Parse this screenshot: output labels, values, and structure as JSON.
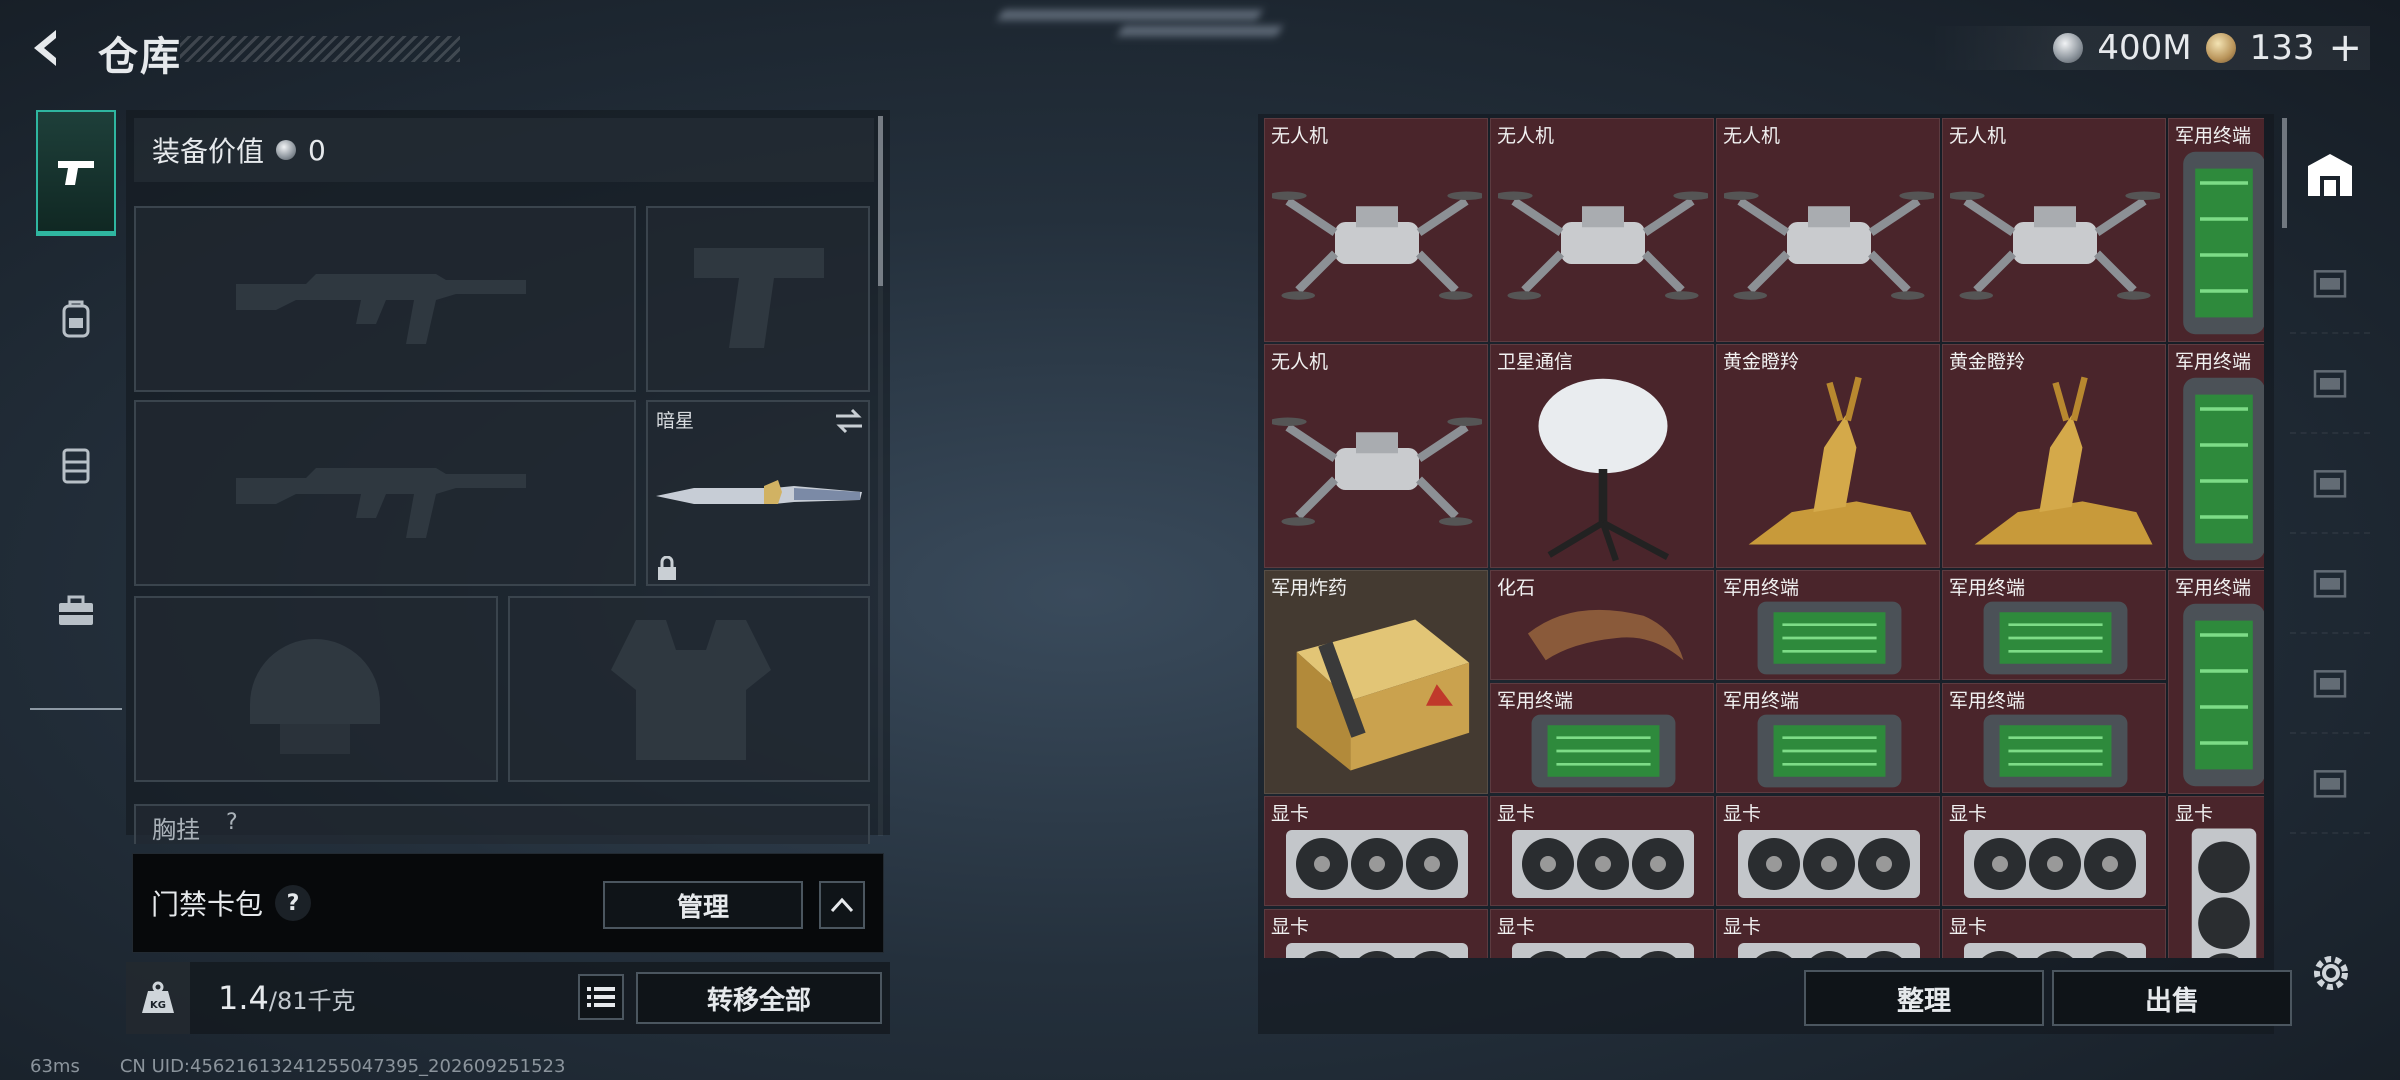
{
  "header": {
    "title": "仓库"
  },
  "currency": {
    "silver_value": "400M",
    "gold_value": "133",
    "add_label": "+"
  },
  "left_tabs": [
    {
      "icon": "pistol-icon",
      "active": true
    },
    {
      "icon": "backpack-icon",
      "active": false
    },
    {
      "icon": "vest-icon",
      "active": false
    },
    {
      "icon": "toolbox-icon",
      "active": false
    }
  ],
  "equipment": {
    "value_label": "装备价值",
    "value": "0",
    "melee_label": "暗星",
    "chest_label": "胸挂",
    "chest_help": "?"
  },
  "access_card": {
    "label": "门禁卡包",
    "help": "?",
    "manage_label": "管理"
  },
  "weight": {
    "current": "1.4",
    "capacity": "/81千克",
    "kg_label": "KG",
    "transfer_label": "转移全部"
  },
  "inventory": {
    "items": [
      {
        "name": "无人机",
        "type": "drone"
      },
      {
        "name": "无人机",
        "type": "drone"
      },
      {
        "name": "无人机",
        "type": "drone"
      },
      {
        "name": "无人机",
        "type": "drone"
      },
      {
        "name": "军用终端",
        "type": "terminal-tall"
      },
      {
        "name": "无人机",
        "type": "drone"
      },
      {
        "name": "卫星通信",
        "type": "satellite"
      },
      {
        "name": "黄金瞪羚",
        "type": "gazelle"
      },
      {
        "name": "黄金瞪羚",
        "type": "gazelle"
      },
      {
        "name": "军用终端",
        "type": "terminal-tall"
      },
      {
        "name": "军用炸药",
        "type": "explosive"
      },
      {
        "name": "化石",
        "type": "fossil"
      },
      {
        "name": "军用终端",
        "type": "terminal"
      },
      {
        "name": "军用终端",
        "type": "terminal"
      },
      {
        "name": "军用终端",
        "type": "terminal-tall"
      },
      {
        "name": "军用终端",
        "type": "terminal"
      },
      {
        "name": "军用终端",
        "type": "terminal"
      },
      {
        "name": "军用终端",
        "type": "terminal"
      },
      {
        "name": "显卡",
        "type": "gpu"
      },
      {
        "name": "显卡",
        "type": "gpu"
      },
      {
        "name": "显卡",
        "type": "gpu"
      },
      {
        "name": "显卡",
        "type": "gpu"
      },
      {
        "name": "显卡",
        "type": "gpu-tall"
      },
      {
        "name": "显卡",
        "type": "gpu"
      },
      {
        "name": "显卡",
        "type": "gpu"
      },
      {
        "name": "显卡",
        "type": "gpu"
      },
      {
        "name": "显卡",
        "type": "gpu"
      }
    ],
    "sort_label": "整理",
    "sell_label": "出售"
  },
  "right_tabs": [
    {
      "icon": "storage-icon",
      "active": true
    },
    {
      "icon": "storage-gti-icon",
      "active": false
    },
    {
      "icon": "storage-v-icon",
      "active": false
    },
    {
      "icon": "storage-iv-medical-icon",
      "active": false
    },
    {
      "icon": "storage-gti-2-icon",
      "active": false
    },
    {
      "icon": "storage-iv-2-icon",
      "active": false
    },
    {
      "icon": "storage-gti-3-icon",
      "active": false
    }
  ],
  "status_bar": {
    "latency": "63ms",
    "uid": "CN UID:45621613241255047395_202609251523"
  },
  "colors": {
    "accent": "#2fb6a0",
    "item_bg": "#4a252b",
    "item_bg_gold": "#443a31"
  }
}
